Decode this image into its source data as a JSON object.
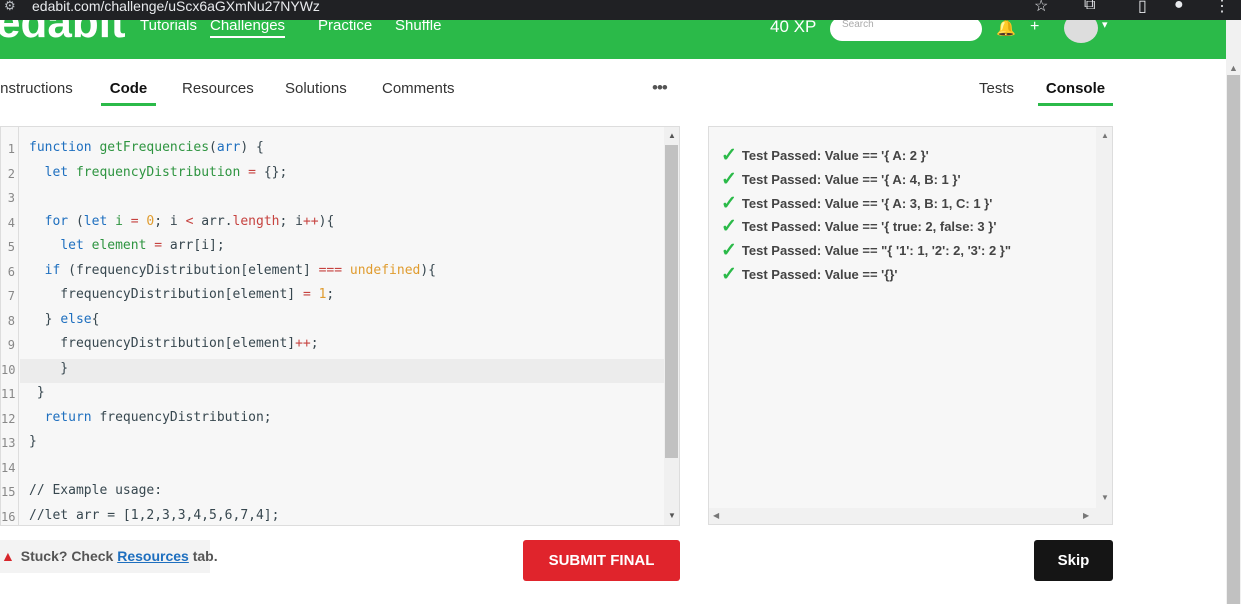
{
  "browser": {
    "url": "edabit.com/challenge/uScx6aGXmNu27NYWz"
  },
  "header": {
    "logo": "edabit",
    "nav": [
      "Tutorials",
      "Challenges",
      "Practice",
      "Shuffle"
    ],
    "xp": "40 XP",
    "search_placeholder": "Search"
  },
  "left_tabs": [
    "Instructions",
    "Code",
    "Resources",
    "Solutions",
    "Comments"
  ],
  "right_tabs": [
    "Tests",
    "Console"
  ],
  "more": "•••",
  "editor": {
    "line_numbers": [
      "1",
      "2",
      "3",
      "4",
      "5",
      "6",
      "7",
      "8",
      "9",
      "10",
      "11",
      "12",
      "13",
      "14",
      "15",
      "16"
    ]
  },
  "console": {
    "results": [
      "Test Passed: Value == '{ A: 2 }'",
      "Test Passed: Value == '{ A: 4, B: 1 }'",
      "Test Passed: Value == '{ A: 3, B: 1, C: 1 }'",
      "Test Passed: Value == '{ true: 2, false: 3 }'",
      "Test Passed: Value == \"{ '1': 1, '2': 2, '3': 2 }\"",
      "Test Passed: Value == '{}'"
    ]
  },
  "footer": {
    "stuck_prefix": "Stuck? Check",
    "stuck_link": "Resources",
    "stuck_suffix": "tab.",
    "submit": "SUBMIT FINAL",
    "skip": "Skip"
  },
  "colors": {
    "brand": "#2bba49",
    "submit": "#e0242c",
    "skip": "#151515"
  }
}
